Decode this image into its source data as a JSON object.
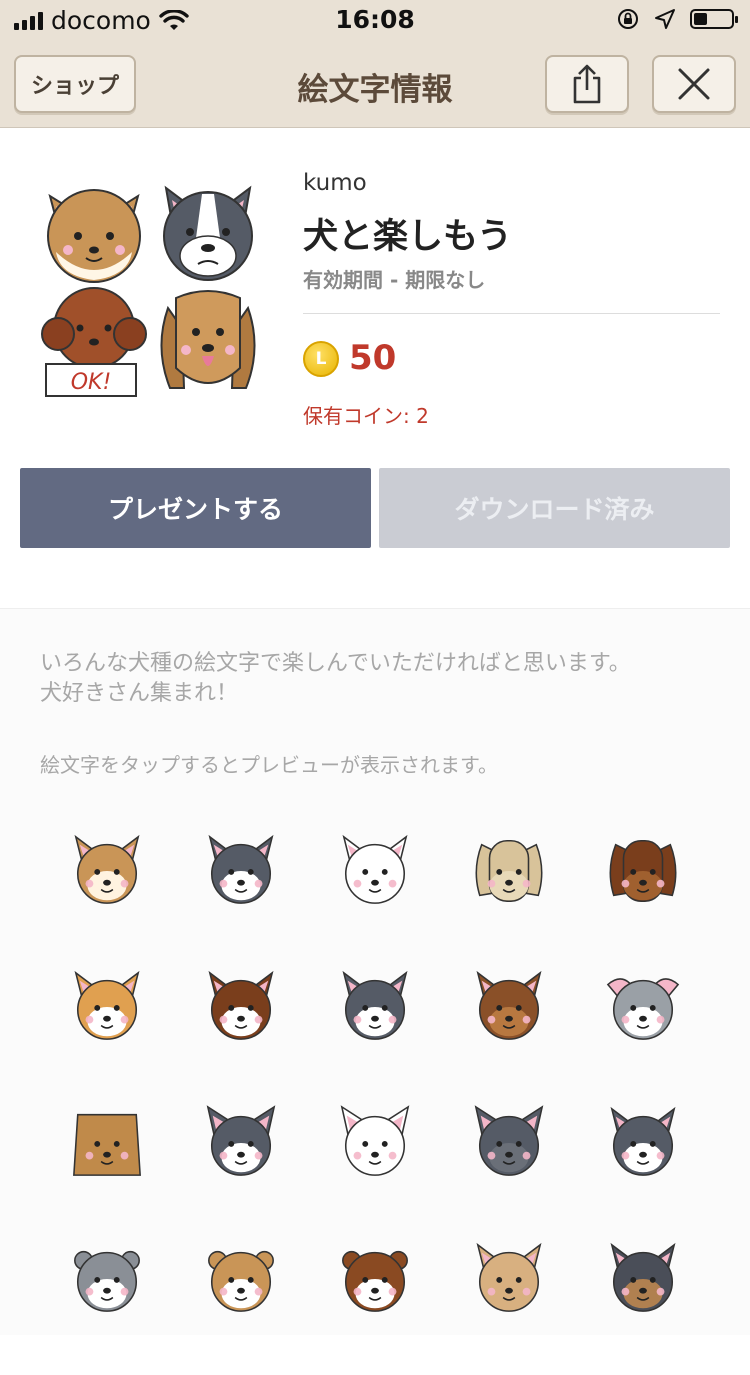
{
  "status_bar": {
    "carrier": "docomo",
    "time": "16:08",
    "battery_level": 0.35
  },
  "nav": {
    "shop_label": "ショップ",
    "title": "絵文字情報",
    "share_icon": "share-icon",
    "close_icon": "close-icon"
  },
  "package": {
    "author": "kumo",
    "title": "犬と楽しもう",
    "validity": "有効期間 - 期限なし",
    "coin_letter": "L",
    "price": "50",
    "owned_coins": "保有コイン: 2",
    "thumbnail_sign": "OK!"
  },
  "buttons": {
    "present": "プレゼントする",
    "download": "ダウンロード済み"
  },
  "description": {
    "line1": "いろんな犬種の絵文字で楽しんでいただければと思います。",
    "line2": "犬好きさん集まれ！",
    "hint": "絵文字をタップするとプレビューが表示されます。"
  },
  "colors": {
    "nav_bg": "#e9e1d5",
    "accent_price": "#c0392b",
    "present_button": "#626a82",
    "download_button_disabled": "#caccd3"
  },
  "emojis": [
    {
      "name": "shiba-tan",
      "fur": "#c99557",
      "face": "#fff3e0",
      "ears": "pointy"
    },
    {
      "name": "shiba-black",
      "fur": "#555b66",
      "face": "#ffffff",
      "ears": "pointy"
    },
    {
      "name": "shiba-white",
      "fur": "#ffffff",
      "face": "#ffffff",
      "ears": "pointy"
    },
    {
      "name": "beagle-cream",
      "fur": "#d8c39a",
      "face": "#e8d9b8",
      "ears": "floppy"
    },
    {
      "name": "dachshund-brown",
      "fur": "#7a3e1c",
      "face": "#a0602f",
      "ears": "floppy"
    },
    {
      "name": "chihuahua-longhair-tan",
      "fur": "#e0a050",
      "face": "#ffffff",
      "ears": "fluffy"
    },
    {
      "name": "papillon-brown",
      "fur": "#7a3e1c",
      "face": "#ffffff",
      "ears": "fluffy"
    },
    {
      "name": "chihuahua-longhair-black",
      "fur": "#555b66",
      "face": "#ffffff",
      "ears": "fluffy"
    },
    {
      "name": "chihuahua-smooth",
      "fur": "#8a5028",
      "face": "#b87840",
      "ears": "pointy"
    },
    {
      "name": "italian-greyhound",
      "fur": "#9aa0a6",
      "face": "#ffffff",
      "ears": "fold"
    },
    {
      "name": "pomeranian",
      "fur": "#c08a4a",
      "face": "#c08a4a",
      "ears": "none"
    },
    {
      "name": "french-bulldog-pied",
      "fur": "#555b66",
      "face": "#ffffff",
      "ears": "bat"
    },
    {
      "name": "french-bulldog-patch",
      "fur": "#ffffff",
      "face": "#ffffff",
      "ears": "bat"
    },
    {
      "name": "french-bulldog-black",
      "fur": "#555b66",
      "face": "#6a6f78",
      "ears": "bat"
    },
    {
      "name": "husky",
      "fur": "#555b66",
      "face": "#ffffff",
      "ears": "pointy"
    },
    {
      "name": "bulldog-grey",
      "fur": "#8a8f96",
      "face": "#ffffff",
      "ears": "bull"
    },
    {
      "name": "bulldog-fawn",
      "fur": "#c99557",
      "face": "#ffffff",
      "ears": "bull"
    },
    {
      "name": "bulldog-brown",
      "fur": "#8a4a22",
      "face": "#ffffff",
      "ears": "bull"
    },
    {
      "name": "yorkie-tan",
      "fur": "#d8b080",
      "face": "#d8b080",
      "ears": "fluffy"
    },
    {
      "name": "yorkie-dark",
      "fur": "#4a4e58",
      "face": "#b08050",
      "ears": "fluffy"
    }
  ]
}
